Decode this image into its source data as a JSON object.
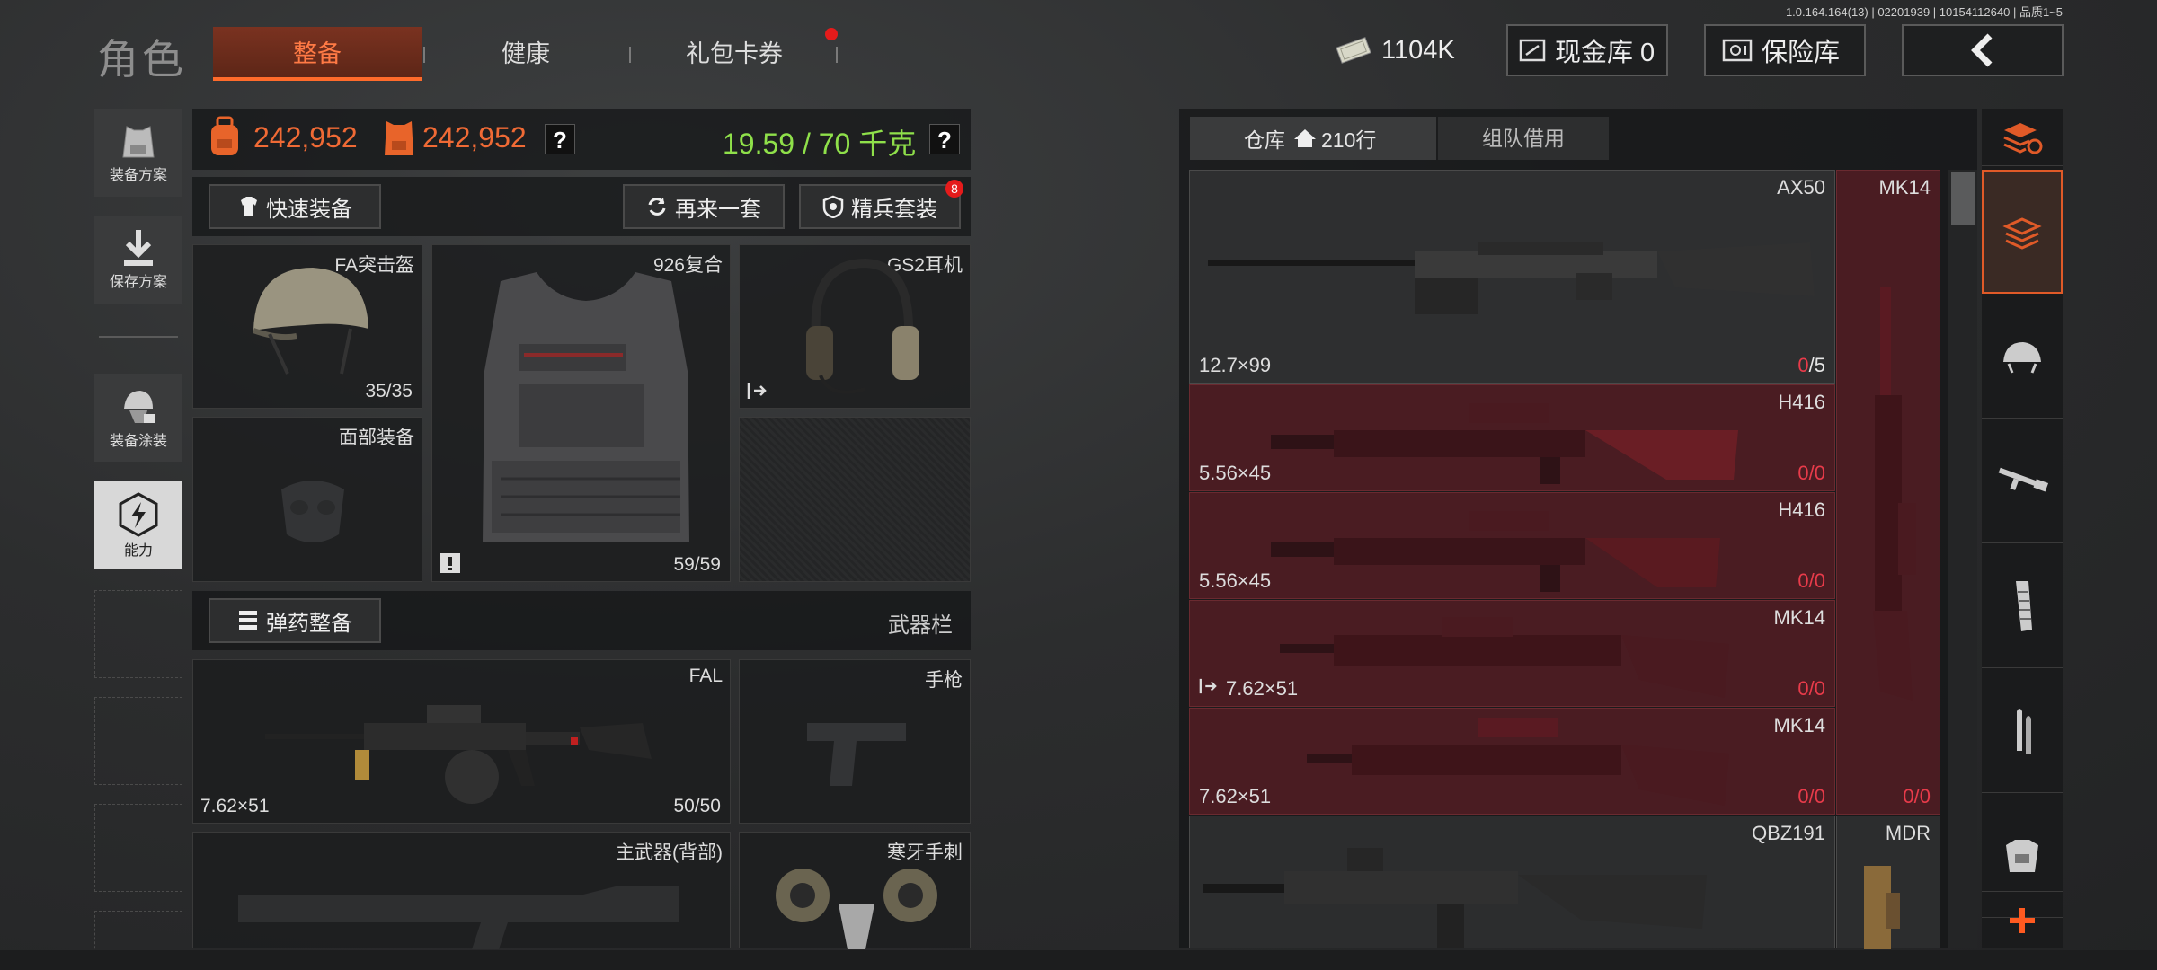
{
  "version": "1.0.164.164(13) | 02201939 | 10154112640 | 品质1~5",
  "header": {
    "title": "角色",
    "tabs": [
      {
        "label": "整备"
      },
      {
        "label": "健康"
      },
      {
        "label": "礼包卡券"
      }
    ],
    "money": "1104K",
    "cash_vault": "现金库 0",
    "insurance_vault": "保险库"
  },
  "sidebar": {
    "items": [
      {
        "label": "装备方案"
      },
      {
        "label": "保存方案"
      },
      {
        "label": "装备涂装"
      },
      {
        "label": "能力"
      }
    ]
  },
  "stats": {
    "value1": "242,952",
    "value2": "242,952",
    "weight": "19.59 / 70 千克",
    "help": "?"
  },
  "actions": {
    "quick_equip": "快速装备",
    "again": "再来一套",
    "elite": "精兵套装",
    "elite_badge": "8",
    "ammo": "弹药整备",
    "weapon_bar": "武器栏"
  },
  "slots": {
    "helmet": {
      "name": "FA突击盔",
      "count": "35/35"
    },
    "armor": {
      "name": "926复合",
      "count": "59/59"
    },
    "headset": {
      "name": "GS2耳机"
    },
    "face": {
      "name": "面部装备"
    },
    "primary": {
      "name": "FAL",
      "caliber": "7.62×51",
      "count": "50/50"
    },
    "pistol": {
      "name": "手枪"
    },
    "back": {
      "name": "主武器(背部)"
    },
    "melee": {
      "name": "寒牙手刺"
    }
  },
  "warehouse": {
    "tab_label": "仓库",
    "rows": "210行",
    "team_tab": "组队借用",
    "items": [
      {
        "name": "AX50",
        "caliber": "12.7×99",
        "used": "0",
        "max": "5"
      },
      {
        "name": "H416",
        "caliber": "5.56×45",
        "used": "0",
        "max": "0"
      },
      {
        "name": "H416",
        "caliber": "5.56×45",
        "used": "0",
        "max": "0"
      },
      {
        "name": "MK14",
        "caliber": "7.62×51",
        "used": "0",
        "max": "0"
      },
      {
        "name": "MK14",
        "caliber": "7.62×51",
        "used": "0",
        "max": "0"
      },
      {
        "name": "QBZ191"
      }
    ],
    "side_items": [
      {
        "name": "MK14",
        "used": "0",
        "max": "0"
      },
      {
        "name": "MDR"
      }
    ]
  },
  "right_tabs": [
    "warehouse-sort-icon",
    "all-items-icon",
    "helmet-icon",
    "rifle-icon",
    "magazine-icon",
    "ammo-icon",
    "armor-icon",
    "add-icon"
  ]
}
